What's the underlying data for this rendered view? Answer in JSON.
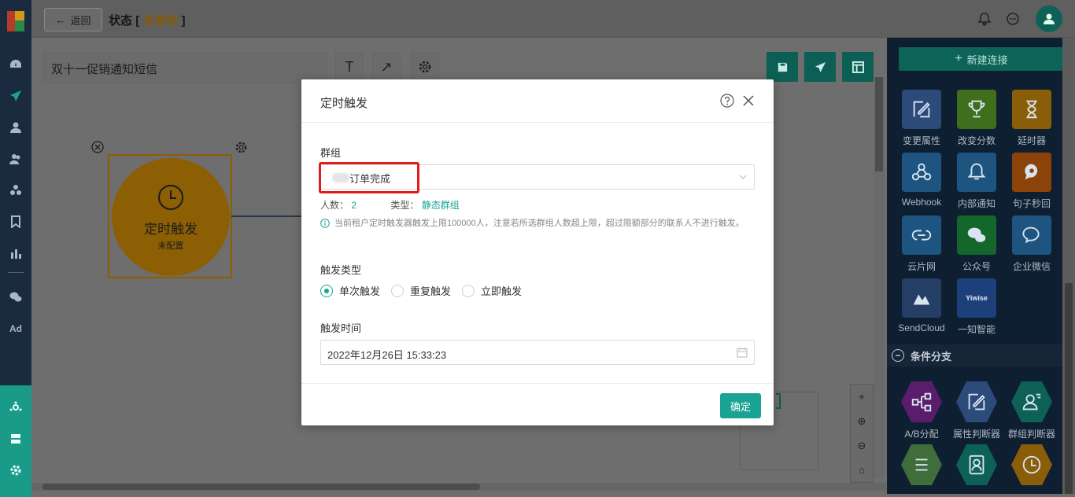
{
  "header": {
    "back_label": "返回",
    "status_label": "状态",
    "status_open": "[",
    "status_value": "未发布",
    "status_close": "]"
  },
  "sidebar": {
    "items": [
      {
        "icon": "dashboard-icon"
      },
      {
        "icon": "send-icon"
      },
      {
        "icon": "user-icon"
      },
      {
        "icon": "users-icon"
      },
      {
        "icon": "cluster-icon"
      },
      {
        "icon": "bookmark-icon"
      },
      {
        "icon": "bar-chart-icon"
      },
      {
        "icon": "wechat-icon"
      },
      {
        "icon": "ad-icon",
        "text": "Ad"
      }
    ],
    "bottom_items": [
      {
        "icon": "integration-icon"
      },
      {
        "icon": "server-icon"
      },
      {
        "icon": "settings-icon"
      }
    ]
  },
  "canvas": {
    "journey_name": "双十一促销通知短信",
    "node": {
      "title": "定时触发",
      "subtitle": "未配置",
      "color": "#8c5f05"
    }
  },
  "right_panel": {
    "new_connection_label": "新建连接",
    "tiles": [
      {
        "label": "变更属性",
        "icon": "edit-icon",
        "color": "#2c4a7a"
      },
      {
        "label": "改变分数",
        "icon": "trophy-icon",
        "color": "#3f6e1c"
      },
      {
        "label": "延时器",
        "icon": "hourglass-icon",
        "color": "#8a5e08"
      },
      {
        "label": "Webhook",
        "icon": "webhook-icon",
        "color": "#1d5580"
      },
      {
        "label": "内部通知",
        "icon": "bell-icon",
        "color": "#1d5580"
      },
      {
        "label": "句子秒回",
        "icon": "chat-bubble-icon",
        "color": "#8c4309"
      },
      {
        "label": "云片网",
        "icon": "cloud-link-icon",
        "color": "#1d5580"
      },
      {
        "label": "公众号",
        "icon": "wechat-icon",
        "color": "#15662b"
      },
      {
        "label": "企业微信",
        "icon": "work-wechat-icon",
        "color": "#1d5580"
      },
      {
        "label": "SendCloud",
        "icon": "sendcloud-icon",
        "color": "#253e66"
      },
      {
        "label": "一知智能",
        "icon": "yiwise-icon",
        "color": "#1d3f7a",
        "logo_text": "Yiwise"
      }
    ],
    "section_title": "条件分支",
    "branch_tiles": [
      {
        "label": "A/B分配",
        "icon": "ab-split-icon",
        "color": "#5a1d6b"
      },
      {
        "label": "属性判断器",
        "icon": "edit-icon",
        "color": "#2c4a7a"
      },
      {
        "label": "群组判断器",
        "icon": "user-list-icon",
        "color": "#0e6157"
      },
      {
        "label": "",
        "icon": "list-icon",
        "color": "#3f6e3a"
      },
      {
        "label": "",
        "icon": "contact-card-icon",
        "color": "#0e6157"
      },
      {
        "label": "",
        "icon": "clock-icon",
        "color": "#8a5e08"
      }
    ]
  },
  "modal": {
    "title": "定时触发",
    "group_label": "群组",
    "group_value": "订单完成",
    "count_label": "人数：",
    "count_value": "2",
    "type_label": "类型：",
    "type_value": "静态群组",
    "notice": "当前租户定时触发器触发上限100000人，注意若所选群组人数超上限，超过限额部分的联系人不进行触发。",
    "trigger_type_label": "触发类型",
    "trigger_options": [
      "单次触发",
      "重复触发",
      "立即触发"
    ],
    "trigger_selected": "单次触发",
    "trigger_time_label": "触发时间",
    "trigger_time_value": "2022年12月26日 15:33:23",
    "confirm_label": "确定",
    "accent_color": "#1aa394"
  }
}
